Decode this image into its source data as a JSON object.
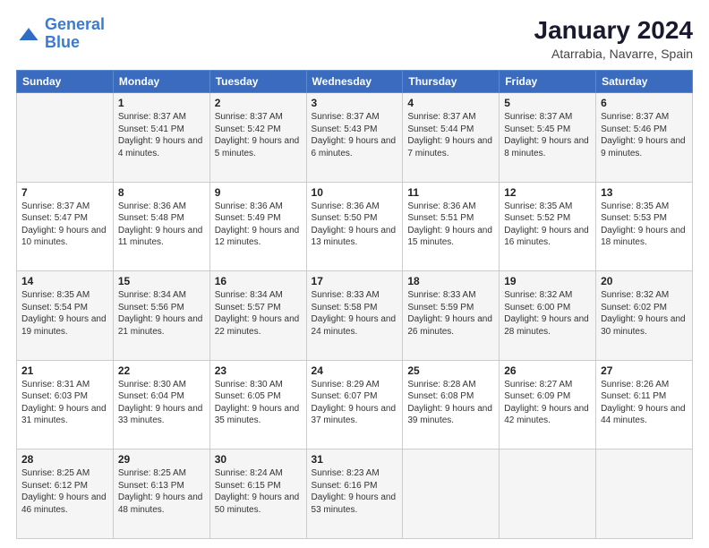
{
  "header": {
    "logo_line1": "General",
    "logo_line2": "Blue",
    "main_title": "January 2024",
    "subtitle": "Atarrabia, Navarre, Spain"
  },
  "weekdays": [
    "Sunday",
    "Monday",
    "Tuesday",
    "Wednesday",
    "Thursday",
    "Friday",
    "Saturday"
  ],
  "weeks": [
    [
      {
        "day": "",
        "sunrise": "",
        "sunset": "",
        "daylight": ""
      },
      {
        "day": "1",
        "sunrise": "Sunrise: 8:37 AM",
        "sunset": "Sunset: 5:41 PM",
        "daylight": "Daylight: 9 hours and 4 minutes."
      },
      {
        "day": "2",
        "sunrise": "Sunrise: 8:37 AM",
        "sunset": "Sunset: 5:42 PM",
        "daylight": "Daylight: 9 hours and 5 minutes."
      },
      {
        "day": "3",
        "sunrise": "Sunrise: 8:37 AM",
        "sunset": "Sunset: 5:43 PM",
        "daylight": "Daylight: 9 hours and 6 minutes."
      },
      {
        "day": "4",
        "sunrise": "Sunrise: 8:37 AM",
        "sunset": "Sunset: 5:44 PM",
        "daylight": "Daylight: 9 hours and 7 minutes."
      },
      {
        "day": "5",
        "sunrise": "Sunrise: 8:37 AM",
        "sunset": "Sunset: 5:45 PM",
        "daylight": "Daylight: 9 hours and 8 minutes."
      },
      {
        "day": "6",
        "sunrise": "Sunrise: 8:37 AM",
        "sunset": "Sunset: 5:46 PM",
        "daylight": "Daylight: 9 hours and 9 minutes."
      }
    ],
    [
      {
        "day": "7",
        "sunrise": "Sunrise: 8:37 AM",
        "sunset": "Sunset: 5:47 PM",
        "daylight": "Daylight: 9 hours and 10 minutes."
      },
      {
        "day": "8",
        "sunrise": "Sunrise: 8:36 AM",
        "sunset": "Sunset: 5:48 PM",
        "daylight": "Daylight: 9 hours and 11 minutes."
      },
      {
        "day": "9",
        "sunrise": "Sunrise: 8:36 AM",
        "sunset": "Sunset: 5:49 PM",
        "daylight": "Daylight: 9 hours and 12 minutes."
      },
      {
        "day": "10",
        "sunrise": "Sunrise: 8:36 AM",
        "sunset": "Sunset: 5:50 PM",
        "daylight": "Daylight: 9 hours and 13 minutes."
      },
      {
        "day": "11",
        "sunrise": "Sunrise: 8:36 AM",
        "sunset": "Sunset: 5:51 PM",
        "daylight": "Daylight: 9 hours and 15 minutes."
      },
      {
        "day": "12",
        "sunrise": "Sunrise: 8:35 AM",
        "sunset": "Sunset: 5:52 PM",
        "daylight": "Daylight: 9 hours and 16 minutes."
      },
      {
        "day": "13",
        "sunrise": "Sunrise: 8:35 AM",
        "sunset": "Sunset: 5:53 PM",
        "daylight": "Daylight: 9 hours and 18 minutes."
      }
    ],
    [
      {
        "day": "14",
        "sunrise": "Sunrise: 8:35 AM",
        "sunset": "Sunset: 5:54 PM",
        "daylight": "Daylight: 9 hours and 19 minutes."
      },
      {
        "day": "15",
        "sunrise": "Sunrise: 8:34 AM",
        "sunset": "Sunset: 5:56 PM",
        "daylight": "Daylight: 9 hours and 21 minutes."
      },
      {
        "day": "16",
        "sunrise": "Sunrise: 8:34 AM",
        "sunset": "Sunset: 5:57 PM",
        "daylight": "Daylight: 9 hours and 22 minutes."
      },
      {
        "day": "17",
        "sunrise": "Sunrise: 8:33 AM",
        "sunset": "Sunset: 5:58 PM",
        "daylight": "Daylight: 9 hours and 24 minutes."
      },
      {
        "day": "18",
        "sunrise": "Sunrise: 8:33 AM",
        "sunset": "Sunset: 5:59 PM",
        "daylight": "Daylight: 9 hours and 26 minutes."
      },
      {
        "day": "19",
        "sunrise": "Sunrise: 8:32 AM",
        "sunset": "Sunset: 6:00 PM",
        "daylight": "Daylight: 9 hours and 28 minutes."
      },
      {
        "day": "20",
        "sunrise": "Sunrise: 8:32 AM",
        "sunset": "Sunset: 6:02 PM",
        "daylight": "Daylight: 9 hours and 30 minutes."
      }
    ],
    [
      {
        "day": "21",
        "sunrise": "Sunrise: 8:31 AM",
        "sunset": "Sunset: 6:03 PM",
        "daylight": "Daylight: 9 hours and 31 minutes."
      },
      {
        "day": "22",
        "sunrise": "Sunrise: 8:30 AM",
        "sunset": "Sunset: 6:04 PM",
        "daylight": "Daylight: 9 hours and 33 minutes."
      },
      {
        "day": "23",
        "sunrise": "Sunrise: 8:30 AM",
        "sunset": "Sunset: 6:05 PM",
        "daylight": "Daylight: 9 hours and 35 minutes."
      },
      {
        "day": "24",
        "sunrise": "Sunrise: 8:29 AM",
        "sunset": "Sunset: 6:07 PM",
        "daylight": "Daylight: 9 hours and 37 minutes."
      },
      {
        "day": "25",
        "sunrise": "Sunrise: 8:28 AM",
        "sunset": "Sunset: 6:08 PM",
        "daylight": "Daylight: 9 hours and 39 minutes."
      },
      {
        "day": "26",
        "sunrise": "Sunrise: 8:27 AM",
        "sunset": "Sunset: 6:09 PM",
        "daylight": "Daylight: 9 hours and 42 minutes."
      },
      {
        "day": "27",
        "sunrise": "Sunrise: 8:26 AM",
        "sunset": "Sunset: 6:11 PM",
        "daylight": "Daylight: 9 hours and 44 minutes."
      }
    ],
    [
      {
        "day": "28",
        "sunrise": "Sunrise: 8:25 AM",
        "sunset": "Sunset: 6:12 PM",
        "daylight": "Daylight: 9 hours and 46 minutes."
      },
      {
        "day": "29",
        "sunrise": "Sunrise: 8:25 AM",
        "sunset": "Sunset: 6:13 PM",
        "daylight": "Daylight: 9 hours and 48 minutes."
      },
      {
        "day": "30",
        "sunrise": "Sunrise: 8:24 AM",
        "sunset": "Sunset: 6:15 PM",
        "daylight": "Daylight: 9 hours and 50 minutes."
      },
      {
        "day": "31",
        "sunrise": "Sunrise: 8:23 AM",
        "sunset": "Sunset: 6:16 PM",
        "daylight": "Daylight: 9 hours and 53 minutes."
      },
      {
        "day": "",
        "sunrise": "",
        "sunset": "",
        "daylight": ""
      },
      {
        "day": "",
        "sunrise": "",
        "sunset": "",
        "daylight": ""
      },
      {
        "day": "",
        "sunrise": "",
        "sunset": "",
        "daylight": ""
      }
    ]
  ]
}
